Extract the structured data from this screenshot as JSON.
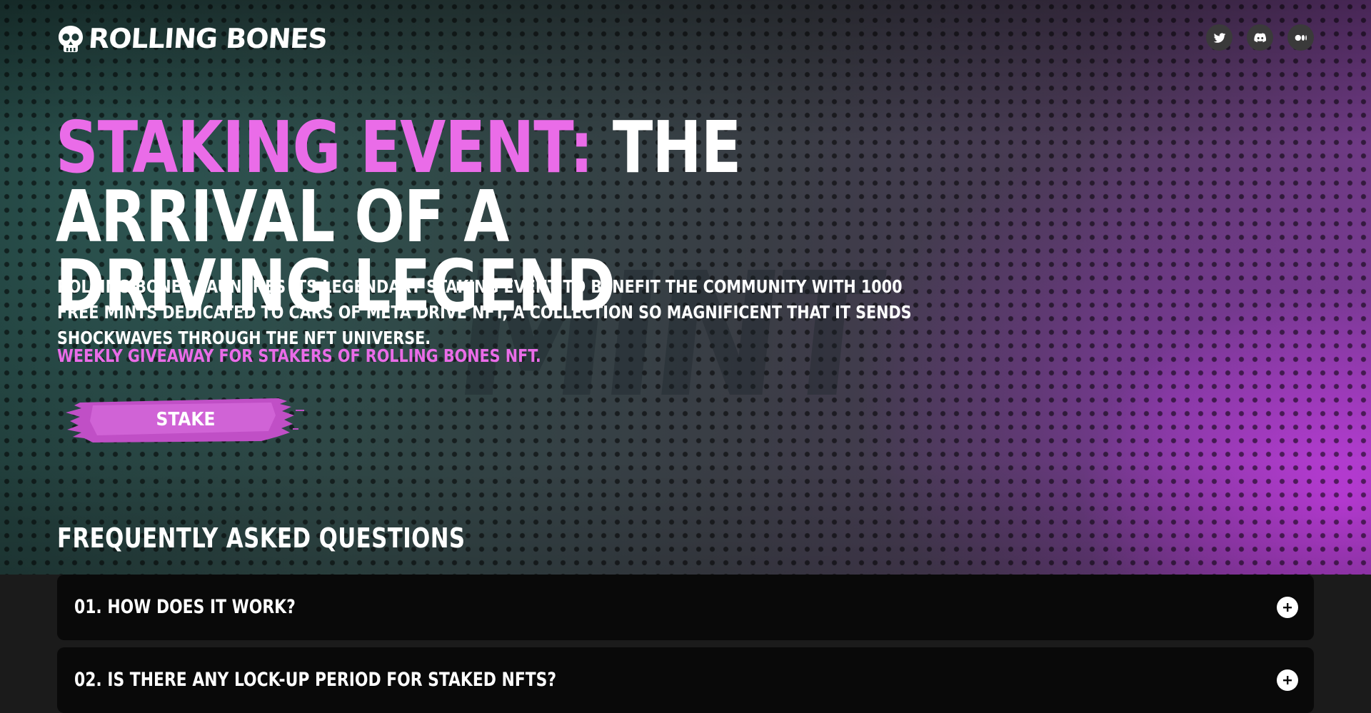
{
  "brand": {
    "name": "ROLLING BONES"
  },
  "socials": [
    {
      "name": "twitter-icon"
    },
    {
      "name": "discord-icon"
    },
    {
      "name": "medium-icon"
    }
  ],
  "hero": {
    "headline_accent": "STAKING EVENT:",
    "headline_line1": " THE ARRIVAL OF A",
    "headline_line2": "DRIVING LEGEND",
    "description": "ROLLING BONES LAUNCHES ITS LEGENDARY STAKING EVENT TO BENEFIT THE COMMUNITY WITH 1000 FREE MINTS DEDICATED TO CARS OF META DRIVE NFT, A COLLECTION SO MAGNIFICENT THAT IT SENDS SHOCKWAVES THROUGH THE NFT UNIVERSE.",
    "giveaway": "WEEKLY GIVEAWAY FOR STAKERS OF ROLLING BONES NFT.",
    "stake_label": "STAKE"
  },
  "faq": {
    "title": "FREQUENTLY ASKED QUESTIONS",
    "items": [
      {
        "question": "01. HOW DOES IT WORK?"
      },
      {
        "question": "02. IS THERE ANY LOCK-UP PERIOD FOR STAKED NFTS?"
      }
    ]
  },
  "colors": {
    "accent": "#ea6ce8",
    "background": "#1b1b1b",
    "faq_card": "#090909"
  }
}
